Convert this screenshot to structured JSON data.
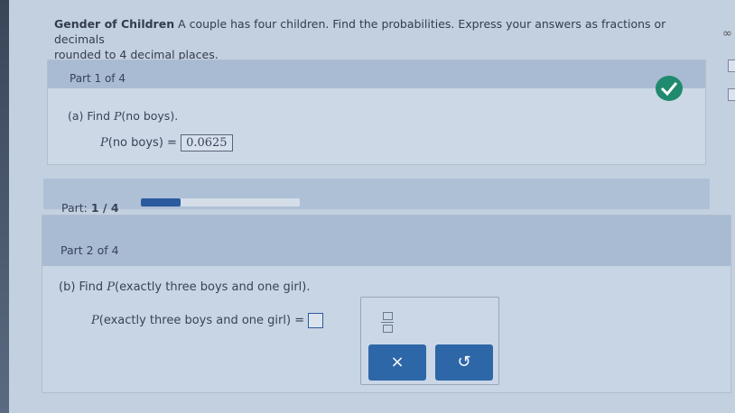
{
  "question": {
    "title": "Gender of Children",
    "text": "A couple has four children. Find the probabilities. Express your answers as fractions or decimals",
    "text2": "rounded to 4 decimal places."
  },
  "icons": {
    "infinity": "∞"
  },
  "part1": {
    "header": "Part 1 of 4",
    "question_prefix": "(a) Find ",
    "question_P": "P",
    "question_arg": "(no boys).",
    "answer_P": "P",
    "answer_arg": "(no boys) =",
    "answer_value": "0.0625"
  },
  "progress": {
    "label": "Part:",
    "value": "1 / 4",
    "fraction": 0.25
  },
  "part2": {
    "header": "Part 2 of 4",
    "question_prefix": "(b) Find ",
    "question_P": "P",
    "question_arg": "(exactly three boys and one girl).",
    "answer_P": "P",
    "answer_arg": "(exactly three boys and one girl) =",
    "clear_label": "×",
    "undo_label": "↺"
  },
  "colors": {
    "accent": "#2e67a8",
    "check": "#1f8a6e"
  }
}
